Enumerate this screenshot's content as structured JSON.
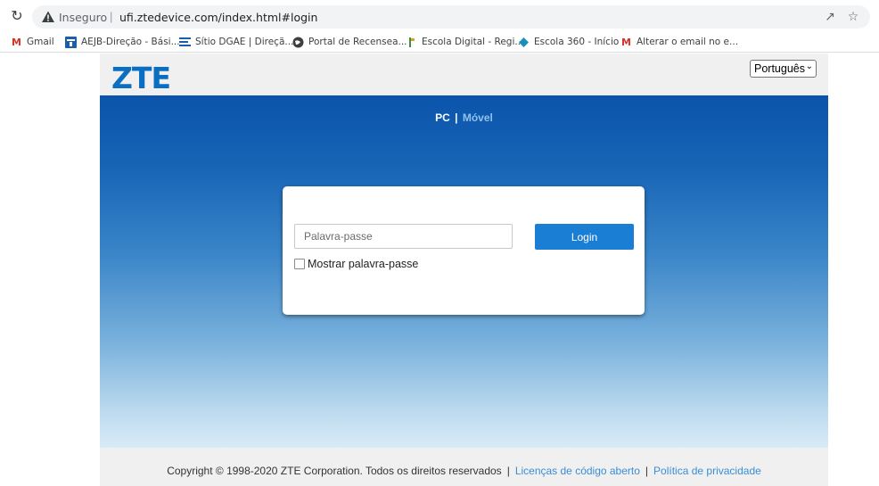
{
  "browser": {
    "insecure_label": "Inseguro",
    "separator": "|",
    "url": "ufi.ztedevice.com/index.html#login",
    "bookmarks": [
      {
        "label": "Gmail",
        "icon": "gmail-icon"
      },
      {
        "label": "AEJB-Direção - Bási...",
        "icon": "site-icon"
      },
      {
        "label": "Sítio DGAE | Direçã...",
        "icon": "doc-icon"
      },
      {
        "label": "Portal de Recensea...",
        "icon": "globe-icon"
      },
      {
        "label": "Escola Digital - Regi...",
        "icon": "flag-icon"
      },
      {
        "label": "Escola 360 - Início",
        "icon": "diamond-icon"
      },
      {
        "label": "Alterar o email no e...",
        "icon": "gmail-icon"
      }
    ]
  },
  "header": {
    "logo": "ZTE",
    "language": "Português"
  },
  "mode_switch": {
    "pc": "PC",
    "sep": "|",
    "mobile": "Móvel"
  },
  "login": {
    "password_placeholder": "Palavra-passe",
    "login_label": "Login",
    "show_password_label": "Mostrar palavra-passe"
  },
  "footer": {
    "copyright": "Copyright © 1998-2020 ZTE Corporation. Todos os direitos reservados",
    "divider": "|",
    "open_source": "Licenças de código aberto",
    "privacy": "Política de privacidade"
  },
  "colors": {
    "brand": "#0a6fc2",
    "login_button": "#1a7ed4",
    "link": "#3b8dd6"
  }
}
